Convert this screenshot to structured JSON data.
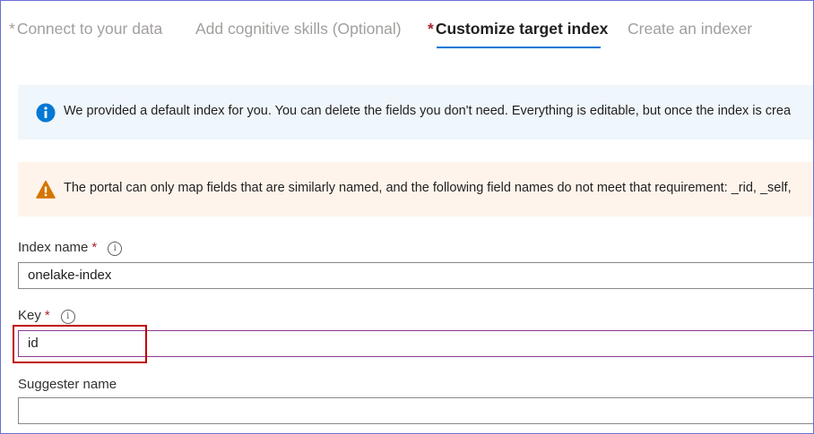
{
  "tabs": [
    {
      "label": "Connect to your data",
      "required": true,
      "state": "visited"
    },
    {
      "label": "Add cognitive skills (Optional)",
      "required": false,
      "state": "visited"
    },
    {
      "label": "Customize target index",
      "required": true,
      "state": "active"
    },
    {
      "label": "Create an indexer",
      "required": false,
      "state": "upcoming"
    }
  ],
  "required_marker": "*",
  "info_banner": {
    "icon": "info-icon",
    "text": "We provided a default index for you. You can delete the fields you don't need. Everything is editable, but once the index is crea"
  },
  "warning_banner": {
    "icon": "warning-icon",
    "text": "The portal can only map fields that are similarly named, and the following field names do not meet that requirement: _rid, _self,"
  },
  "form": {
    "index_name": {
      "label": "Index name",
      "required": true,
      "value": "onelake-index"
    },
    "key": {
      "label": "Key",
      "required": true,
      "value": "id"
    },
    "suggester_name": {
      "label": "Suggester name",
      "required": false,
      "value": ""
    }
  },
  "colors": {
    "accent": "#0078d4",
    "required": "#a4262c",
    "info_bg": "#eff6fc",
    "warn_bg": "#fff4ec",
    "highlight": "#c00000"
  }
}
